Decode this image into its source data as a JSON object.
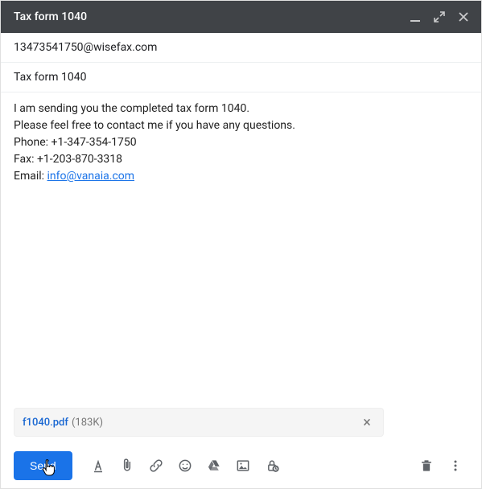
{
  "window": {
    "title": "Tax form 1040"
  },
  "to": "13473541750@wisefax.com",
  "subject": "Tax form 1040",
  "body": {
    "line1": "I am sending you the completed tax form 1040.",
    "line2": "Please feel free to contact me if you have any questions.",
    "phone_label": "Phone: ",
    "phone": "+1-347-354-1750",
    "fax_label": "Fax: ",
    "fax": "+1-203-870-3318",
    "email_label": "Email: ",
    "email_link": "info@vanaia.com"
  },
  "attachment": {
    "name": "f1040.pdf",
    "size": "(183K)"
  },
  "toolbar": {
    "send_label": "Send"
  }
}
